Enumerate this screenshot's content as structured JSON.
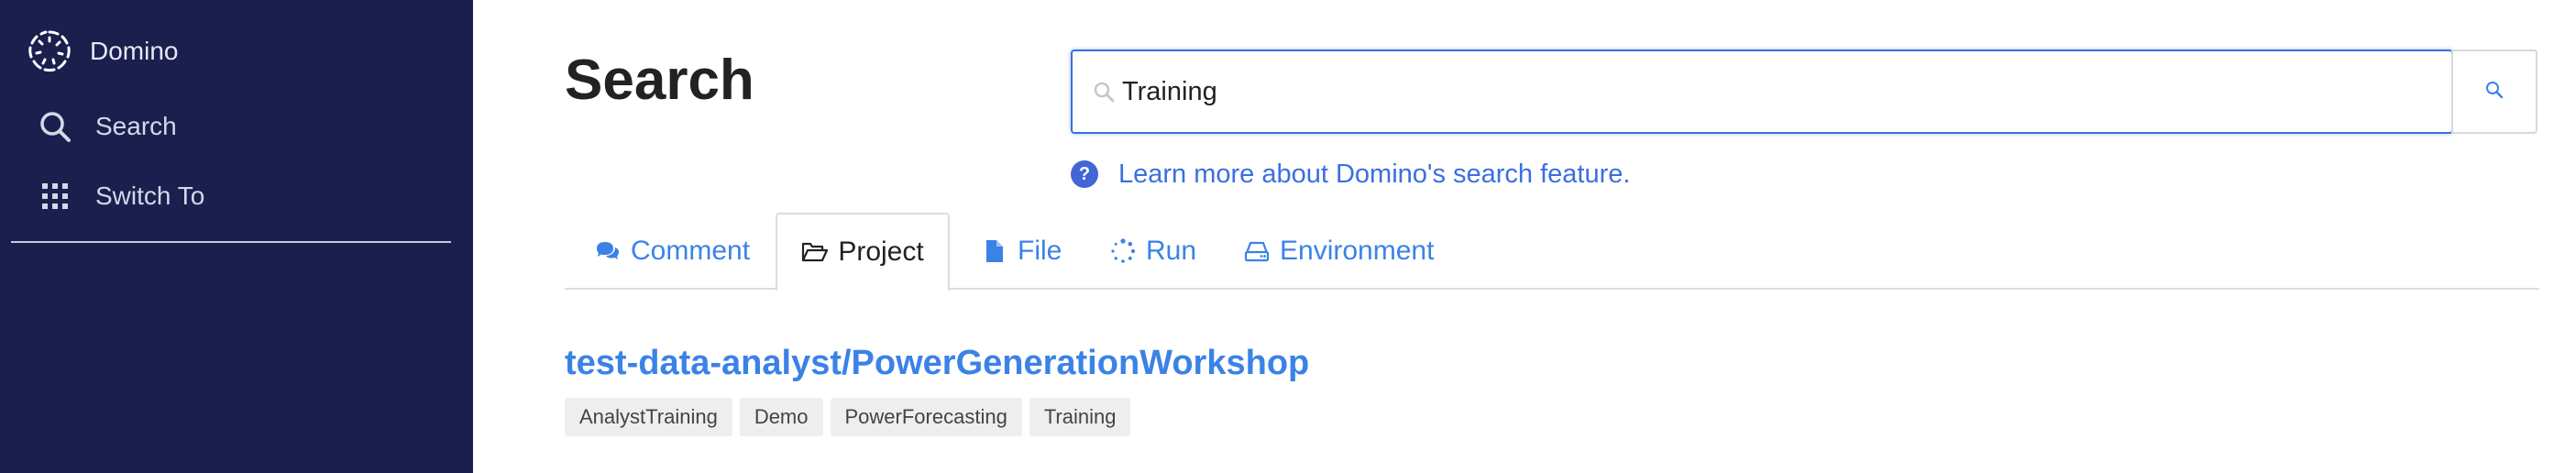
{
  "sidebar": {
    "brand": "Domino",
    "items": [
      {
        "label": "Search",
        "icon": "search-icon"
      },
      {
        "label": "Switch To",
        "icon": "grid-icon"
      }
    ]
  },
  "main": {
    "title": "Search",
    "search": {
      "value": "Training",
      "placeholder": ""
    },
    "help_link": "Learn more about Domino's search feature.",
    "tabs": [
      {
        "label": "Comment",
        "icon": "comments-icon",
        "active": false
      },
      {
        "label": "Project",
        "icon": "folder-open-icon",
        "active": true
      },
      {
        "label": "File",
        "icon": "file-icon",
        "active": false
      },
      {
        "label": "Run",
        "icon": "spinner-icon",
        "active": false
      },
      {
        "label": "Environment",
        "icon": "hdd-icon",
        "active": false
      }
    ],
    "result": {
      "title": "test-data-analyst/PowerGenerationWorkshop",
      "tags": [
        "AnalystTraining",
        "Demo",
        "PowerForecasting",
        "Training"
      ]
    }
  },
  "colors": {
    "sidebar_bg": "#1a1f4e",
    "link": "#3b82e6",
    "focus_border": "#3b6fe0",
    "help_icon": "#4266d8"
  }
}
